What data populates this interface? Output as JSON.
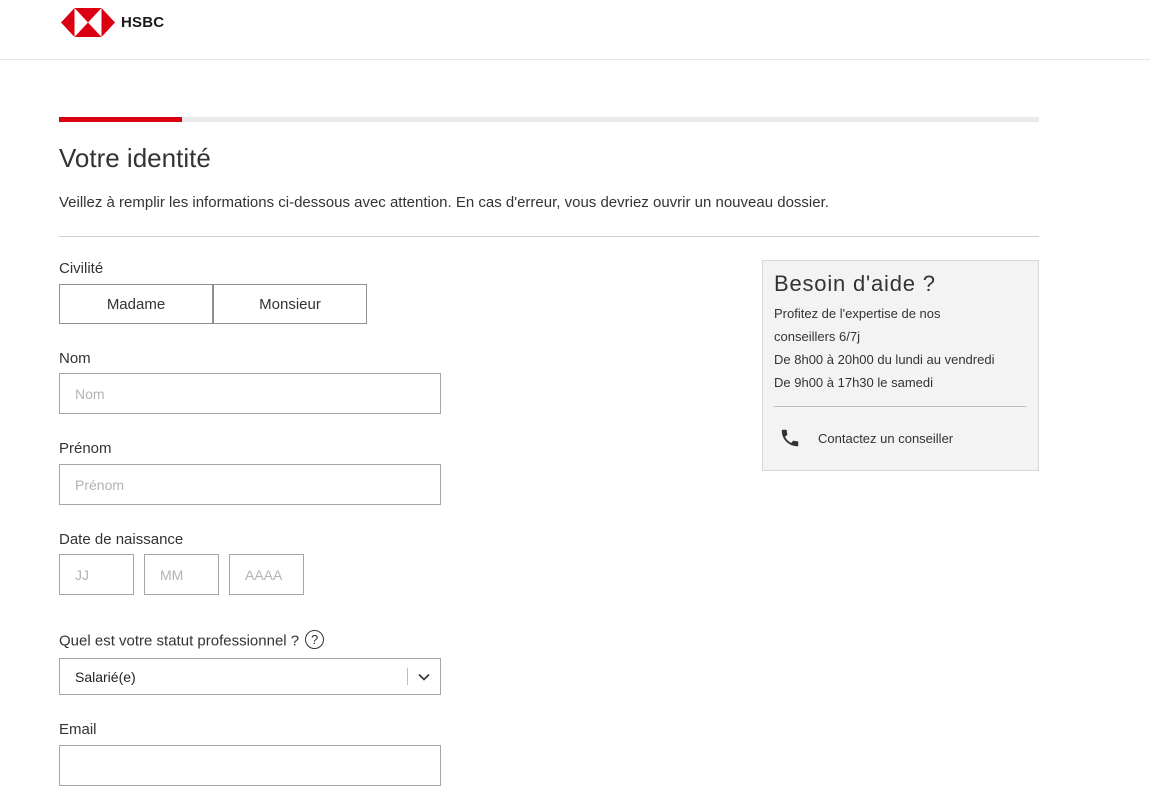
{
  "brand": {
    "name": "HSBC",
    "red": "#db0011"
  },
  "progress": {
    "fraction": 0.125
  },
  "page": {
    "title": "Votre identité",
    "intro": "Veillez à remplir les informations ci-dessous avec attention. En cas d'erreur, vous devriez ouvrir un nouveau dossier."
  },
  "form": {
    "civility": {
      "label": "Civilité",
      "options": [
        "Madame",
        "Monsieur"
      ]
    },
    "last_name": {
      "label": "Nom",
      "placeholder": "Nom",
      "value": ""
    },
    "first_name": {
      "label": "Prénom",
      "placeholder": "Prénom",
      "value": ""
    },
    "birth_date": {
      "label": "Date de naissance",
      "day_placeholder": "JJ",
      "month_placeholder": "MM",
      "year_placeholder": "AAAA"
    },
    "status": {
      "label": "Quel est votre statut professionnel ?",
      "help_icon": "question-circle-icon",
      "help_glyph": "?",
      "value": "Salarié(e)"
    },
    "email": {
      "label": "Email",
      "value": ""
    }
  },
  "help": {
    "title": "Besoin d'aide ?",
    "lines": [
      "Profitez de l'expertise de nos",
      "conseillers 6/7j",
      "De 8h00 à 20h00 du lundi au vendredi",
      "De 9h00 à 17h30 le samedi"
    ],
    "contact_icon": "phone-icon",
    "contact_label": "Contactez un conseiller"
  }
}
